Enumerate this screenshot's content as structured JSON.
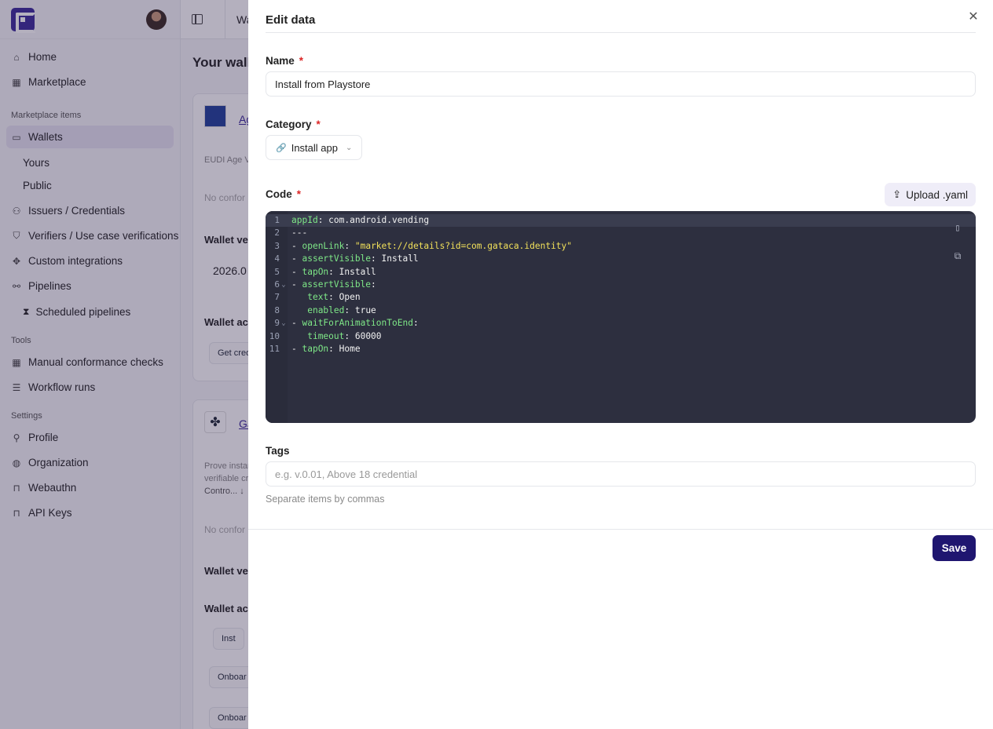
{
  "sidebar": {
    "items_main": [
      {
        "label": "Home",
        "icon": "home-icon"
      },
      {
        "label": "Marketplace",
        "icon": "store-icon"
      }
    ],
    "section_marketplace": "Marketplace items",
    "wallets_label": "Wallets",
    "wallets_sub": [
      "Yours",
      "Public"
    ],
    "items_marketplace": [
      {
        "label": "Issuers / Credentials"
      },
      {
        "label": "Verifiers / Use case verifications"
      },
      {
        "label": "Custom integrations"
      },
      {
        "label": "Pipelines"
      }
    ],
    "scheduled_pipelines": "Scheduled pipelines",
    "section_tools": "Tools",
    "items_tools": [
      {
        "label": "Manual conformance checks"
      },
      {
        "label": "Workflow runs"
      }
    ],
    "section_settings": "Settings",
    "items_settings": [
      {
        "label": "Profile"
      },
      {
        "label": "Organization"
      },
      {
        "label": "Webauthn"
      },
      {
        "label": "API Keys"
      }
    ]
  },
  "main": {
    "breadcrumb": "Walle",
    "title": "Your wall",
    "card1": {
      "link": "Ag",
      "desc": "EUDI Age Ve",
      "no_conf": "No confor",
      "wallet_ver": "Wallet ver",
      "version": "2026.0",
      "wallet_act": "Wallet act",
      "chip": "Get cred"
    },
    "card2": {
      "link": "Ga",
      "desc1": "Prove instar",
      "desc2": "verifiable cr",
      "desc3": "Contro... ↓",
      "no_conf": "No confor",
      "wallet_ver": "Wallet ver",
      "wallet_act": "Wallet act",
      "chip1": "Inst",
      "chip2": "Onboar",
      "chip3": "Onboar"
    }
  },
  "drawer": {
    "title": "Edit data",
    "name_label": "Name",
    "name_value": "Install from Playstore",
    "category_label": "Category",
    "category_value": "Install app",
    "code_label": "Code",
    "upload_label": "Upload .yaml",
    "code_lines": [
      "appId: com.android.vending",
      "---",
      "- openLink: \"market://details?id=com.gataca.identity\"",
      "- assertVisible: Install",
      "- tapOn: Install",
      "- assertVisible:",
      "   text: Open",
      "   enabled: true",
      "- waitForAnimationToEnd:",
      "   timeout: 60000",
      "- tapOn: Home"
    ],
    "tags_label": "Tags",
    "tags_placeholder": "e.g. v.0.01, Above 18 credential",
    "tags_hint": "Separate items by commas",
    "save_label": "Save",
    "required_mark": "*"
  },
  "colors": {
    "accent": "#1f1670",
    "editor_bg": "#2d2f3f",
    "key_green": "#7ee787",
    "string_yellow": "#f1e05a",
    "required_red": "#dc2626"
  }
}
